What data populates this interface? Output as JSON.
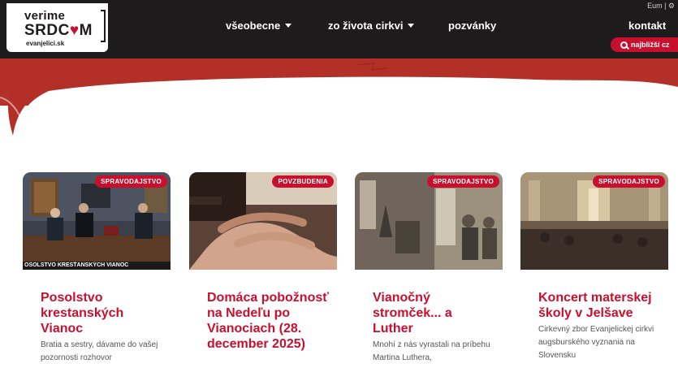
{
  "logo": {
    "line1": "verime",
    "line2a": "SRDC",
    "line2b": "M",
    "line3": "evanjelici.sk"
  },
  "nav": {
    "items": [
      {
        "label": "všeobecne"
      },
      {
        "label": "zo života cirkvi"
      },
      {
        "label": "pozvánky"
      }
    ],
    "contact": "kontakt",
    "search": "najbližší cz",
    "top_mini": "Eum | ⚙"
  },
  "colors": {
    "accent": "#c8102e",
    "nav_bg": "#1d1b1b"
  },
  "cards": [
    {
      "category": "SPRAVODAJSTVO",
      "title": "Posolstvo krestanských Vianoc",
      "excerpt": "Bratia a sestry, dávame do vašej pozornosti rozhovor",
      "caption": "OSOLSTVO KRESŤANSKÝCH VIANOC"
    },
    {
      "category": "POVZBUDENIA",
      "title": "Domáca pobožnosť na Nedeľu po Vianociach (28. december 2025)",
      "excerpt": "",
      "caption": ""
    },
    {
      "category": "SPRAVODAJSTVO",
      "title": "Vianočný stromček... a Luther",
      "excerpt": "Mnohí z nás vyrastali na príbehu Martina Luthera,",
      "caption": ""
    },
    {
      "category": "SPRAVODAJSTVO",
      "title": "Koncert materskej školy v Jelšave",
      "excerpt": "Cirkevný zbor Evanjelickej cirkvi augsburského vyznania na Slovensku",
      "caption": ""
    }
  ]
}
